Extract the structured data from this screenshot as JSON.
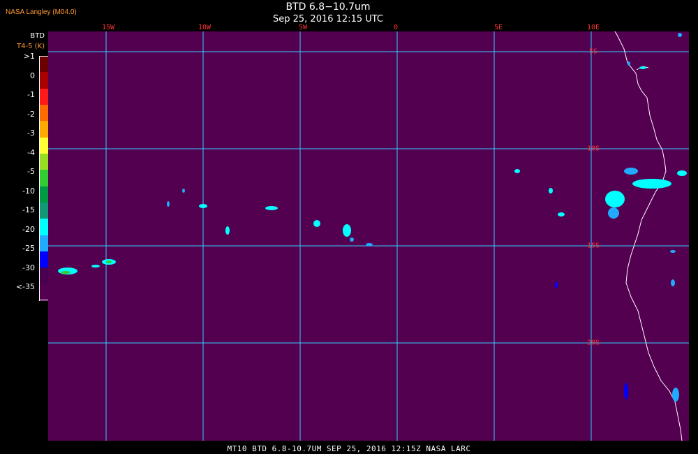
{
  "header": {
    "credit": "NASA Langley (M04.0)",
    "title": "BTD 6.8−10.7um",
    "subtitle": "Sep 25, 2016 12:15 UTC"
  },
  "footer": {
    "text": "MT10   BTD 6.8-10.7UM   SEP 25, 2016 12:15Z   NASA LARC"
  },
  "legend": {
    "title": "BTD",
    "units": "T4-5 (K)",
    "labels": [
      ">1",
      "0",
      "-1",
      "-2",
      "-3",
      "-4",
      "-5",
      "-10",
      "-15",
      "-20",
      "-25",
      "-30",
      "<-35"
    ],
    "colors": [
      "#6a0000",
      "#aa0000",
      "#ff1a1a",
      "#ff6a00",
      "#ffaa00",
      "#ffff33",
      "#99dd22",
      "#33cc33",
      "#009944",
      "#119977",
      "#00ffff",
      "#22aaff",
      "#0000ff",
      "#4a0050",
      "#530050"
    ]
  },
  "colors": {
    "grid": "#33ccff",
    "coast": "#ffffff",
    "background": "#530050",
    "label": "#ff3333"
  },
  "map": {
    "lon_ticks": [
      "15W",
      "10W",
      "5W",
      "0",
      "5E",
      "10E"
    ],
    "lat_ticks": [
      "5S",
      "10S",
      "15S",
      "20S"
    ]
  }
}
